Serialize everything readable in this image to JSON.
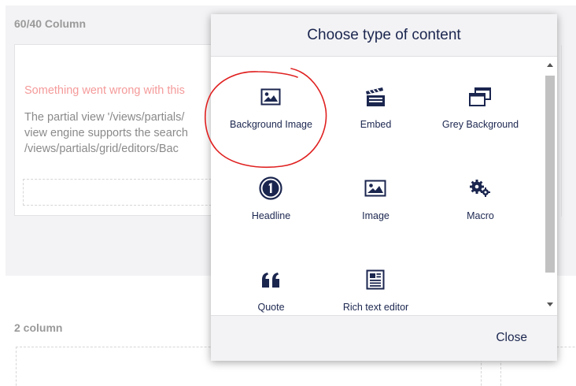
{
  "background": {
    "section1_title": "60/40 Column",
    "error_title": "Something went wrong with this",
    "error_lines": [
      "The partial view '/views/partials/",
      "view engine supports the search",
      "/views/partials/grid/editors/Bac"
    ],
    "section2_title": "2 column"
  },
  "dialog": {
    "title": "Choose type of content",
    "close_label": "Close",
    "items": [
      {
        "label": "Background Image",
        "icon": "picture-icon"
      },
      {
        "label": "Embed",
        "icon": "movie-clapper-icon"
      },
      {
        "label": "Grey Background",
        "icon": "windows-icon"
      },
      {
        "label": "Headline",
        "icon": "circle-one-icon"
      },
      {
        "label": "Image",
        "icon": "picture-icon"
      },
      {
        "label": "Macro",
        "icon": "gears-icon"
      },
      {
        "label": "Quote",
        "icon": "quote-icon"
      },
      {
        "label": "Rich text editor",
        "icon": "newspaper-icon"
      }
    ]
  },
  "colors": {
    "text_dark": "#1b264f",
    "error_text": "#f59a9a",
    "annotation": "#e02020",
    "panel_grey": "#f3f3f5"
  }
}
